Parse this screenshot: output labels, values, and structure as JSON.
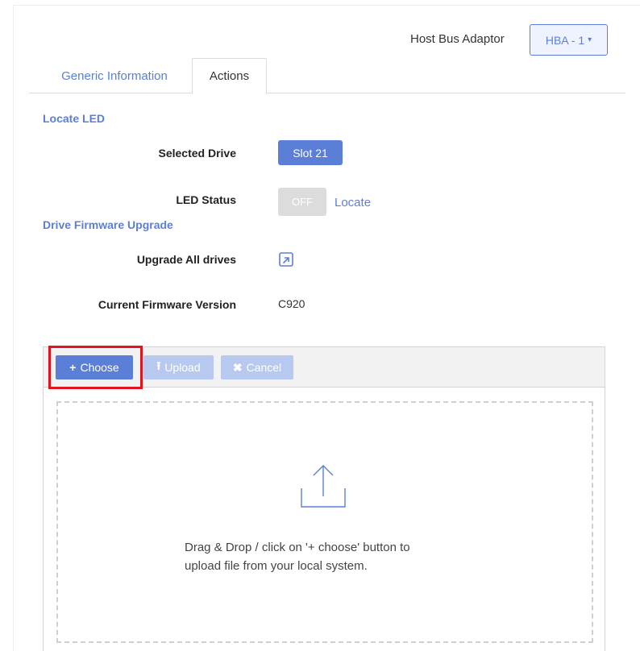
{
  "header": {
    "hba_label": "Host Bus Adaptor",
    "hba_value": "HBA - 1",
    "hba_caret": "▾"
  },
  "tabs": [
    {
      "label": "Generic Information",
      "active": false
    },
    {
      "label": "Actions",
      "active": true
    }
  ],
  "locate_led": {
    "title": "Locate LED",
    "selected_drive_label": "Selected Drive",
    "selected_drive_value": "Slot 21",
    "led_status_label": "LED Status",
    "led_status_value": "OFF",
    "locate_link": "Locate"
  },
  "firmware": {
    "title": "Drive Firmware Upgrade",
    "upgrade_all_label": "Upgrade All drives",
    "upgrade_icon": "external-link-icon",
    "current_version_label": "Current Firmware Version",
    "current_version_value": "C920"
  },
  "uploader": {
    "choose_icon": "+",
    "choose_label": "Choose",
    "upload_icon": "⭱",
    "upload_label": "Upload",
    "cancel_icon": "✖",
    "cancel_label": "Cancel",
    "drop_text_line1": "Drag & Drop / click on '+ choose' button to",
    "drop_text_line2": "upload file from your local system.",
    "drop_icon": "upload-icon"
  },
  "colors": {
    "accent": "#5b7fd6",
    "accent_disabled": "#b8c9ef",
    "highlight": "#e0141c"
  }
}
